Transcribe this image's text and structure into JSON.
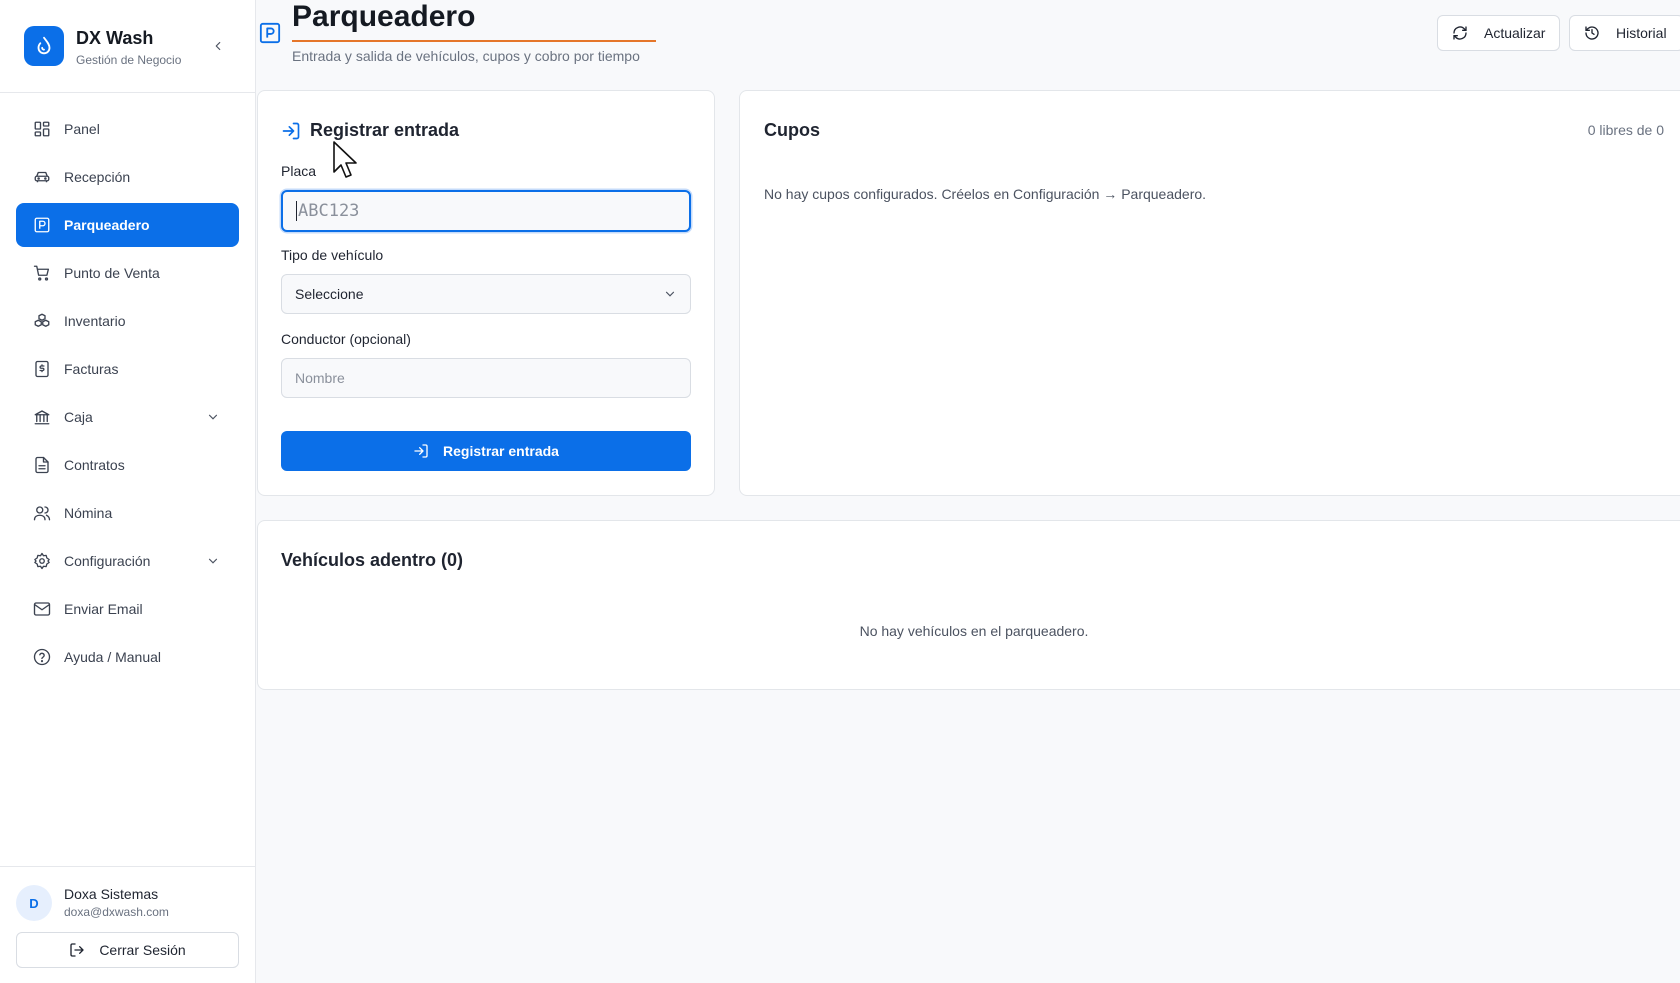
{
  "brand": {
    "name": "DX Wash",
    "subtitle": "Gestión de Negocio"
  },
  "sidebar": {
    "items": [
      {
        "label": "Panel",
        "icon": "dashboard-icon"
      },
      {
        "label": "Recepción",
        "icon": "car-icon"
      },
      {
        "label": "Parqueadero",
        "icon": "parking-icon",
        "active": true
      },
      {
        "label": "Punto de Venta",
        "icon": "cart-icon"
      },
      {
        "label": "Inventario",
        "icon": "boxes-icon"
      },
      {
        "label": "Facturas",
        "icon": "invoice-icon"
      },
      {
        "label": "Caja",
        "icon": "bank-icon",
        "expandable": true
      },
      {
        "label": "Contratos",
        "icon": "document-icon"
      },
      {
        "label": "Nómina",
        "icon": "users-icon"
      },
      {
        "label": "Configuración",
        "icon": "gear-icon",
        "expandable": true
      },
      {
        "label": "Enviar Email",
        "icon": "mail-icon"
      },
      {
        "label": "Ayuda / Manual",
        "icon": "help-icon"
      }
    ]
  },
  "user": {
    "initial": "D",
    "name": "Doxa Sistemas",
    "email": "doxa@dxwash.com",
    "logout_label": "Cerrar Sesión"
  },
  "header": {
    "title": "Parqueadero",
    "subtitle": "Entrada y salida de vehículos, cupos y cobro por tiempo",
    "refresh_label": "Actualizar",
    "history_label": "Historial"
  },
  "entry_form": {
    "title": "Registrar entrada",
    "placa_label": "Placa",
    "placa_placeholder": "ABC123",
    "tipo_label": "Tipo de vehículo",
    "tipo_selected": "Seleccione",
    "conductor_label": "Conductor (opcional)",
    "conductor_placeholder": "Nombre",
    "submit_label": "Registrar entrada"
  },
  "cupos": {
    "title": "Cupos",
    "count_text": "0 libres de 0",
    "empty_text": "No hay cupos configurados. Créelos en Configuración → Parqueadero."
  },
  "vehicles": {
    "title": "Vehículos adentro (0)",
    "empty_text": "No hay vehículos en el parqueadero."
  },
  "colors": {
    "accent": "#0b6fe8",
    "title_underline": "#e5762a"
  }
}
